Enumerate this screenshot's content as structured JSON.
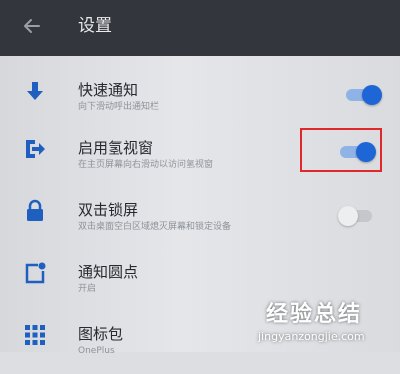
{
  "header": {
    "back_icon": "arrow-left-icon",
    "title": "设置"
  },
  "items": [
    {
      "label": "快速通知",
      "subtitle": "向下滑动呼出通知栏",
      "icon": "arrow-down-icon",
      "toggle": true
    },
    {
      "label": "启用氢视窗",
      "subtitle": "在主页屏幕向右滑动以访问氢视窗",
      "icon": "exit-icon",
      "toggle": true
    },
    {
      "label": "双击锁屏",
      "subtitle": "双击桌面空白区域熄灭屏幕和锁定设备",
      "icon": "lock-icon",
      "toggle": false
    },
    {
      "label": "通知圆点",
      "subtitle": "开启",
      "icon": "notification-dot-icon"
    },
    {
      "label": "图标包",
      "subtitle": "OnePlus",
      "icon": "grid-icon"
    }
  ],
  "colors": {
    "accent": "#1e66d6",
    "highlight": "#e0282a"
  },
  "watermark": {
    "title": "经验总结",
    "url": "jingyanzongjie.com"
  }
}
